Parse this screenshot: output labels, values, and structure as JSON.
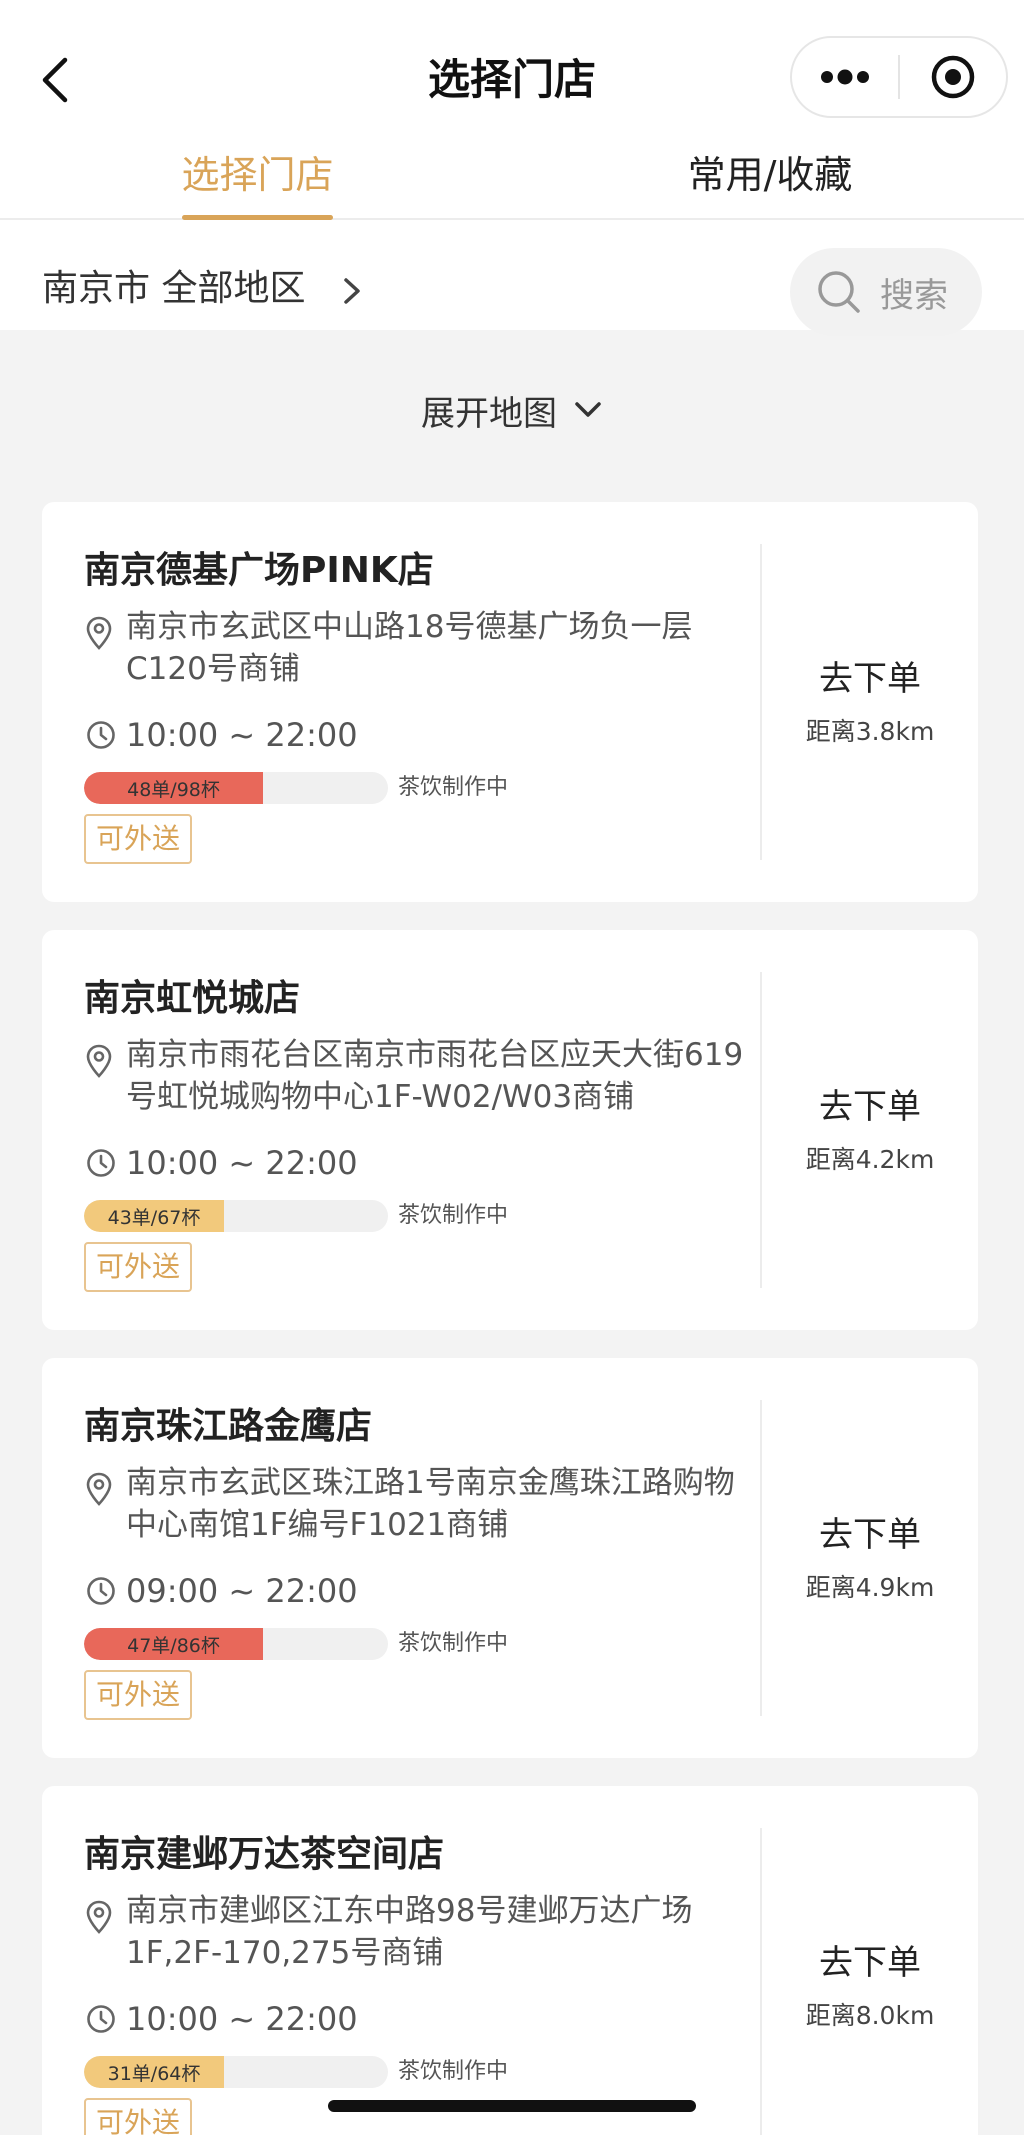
{
  "header": {
    "title": "选择门店"
  },
  "tabs": [
    {
      "label": "选择门店"
    },
    {
      "label": "常用/收藏"
    }
  ],
  "location": {
    "city": "南京市 全部地区"
  },
  "search": {
    "placeholder": "搜索"
  },
  "map_toggle": {
    "label": "展开地图"
  },
  "colors": {
    "accent": "#d9a458",
    "busy_red": "#e8685a",
    "normal_yellow": "#f2c97c"
  },
  "stores": [
    {
      "name": "南京德基广场PINK店",
      "address": "南京市玄武区中山路18号德基广场负一层C120号商铺",
      "hours": "10:00 ~ 22:00",
      "progress_label": "48单/98杯",
      "progress_fraction": 0.59,
      "progress_color": "#e8685a",
      "status": "茶饮制作中",
      "tag": "可外送",
      "action": "去下单",
      "distance": "距离3.8km"
    },
    {
      "name": "南京虹悦城店",
      "address": "南京市雨花台区南京市雨花台区应天大街619号虹悦城购物中心1F-W02/W03商铺",
      "hours": "10:00 ~ 22:00",
      "progress_label": "43单/67杯",
      "progress_fraction": 0.46,
      "progress_color": "#f2c97c",
      "status": "茶饮制作中",
      "tag": "可外送",
      "action": "去下单",
      "distance": "距离4.2km"
    },
    {
      "name": "南京珠江路金鹰店",
      "address": "南京市玄武区珠江路1号南京金鹰珠江路购物中心南馆1F编号F1021商铺",
      "hours": "09:00 ~ 22:00",
      "progress_label": "47单/86杯",
      "progress_fraction": 0.59,
      "progress_color": "#e8685a",
      "status": "茶饮制作中",
      "tag": "可外送",
      "action": "去下单",
      "distance": "距离4.9km"
    },
    {
      "name": "南京建邺万达茶空间店",
      "address": "南京市建邺区江东中路98号建邺万达广场1F,2F-170,275号商铺",
      "hours": "10:00 ~ 22:00",
      "progress_label": "31单/64杯",
      "progress_fraction": 0.46,
      "progress_color": "#f2c97c",
      "status": "茶饮制作中",
      "tag": "可外送",
      "action": "去下单",
      "distance": "距离8.0km"
    }
  ]
}
